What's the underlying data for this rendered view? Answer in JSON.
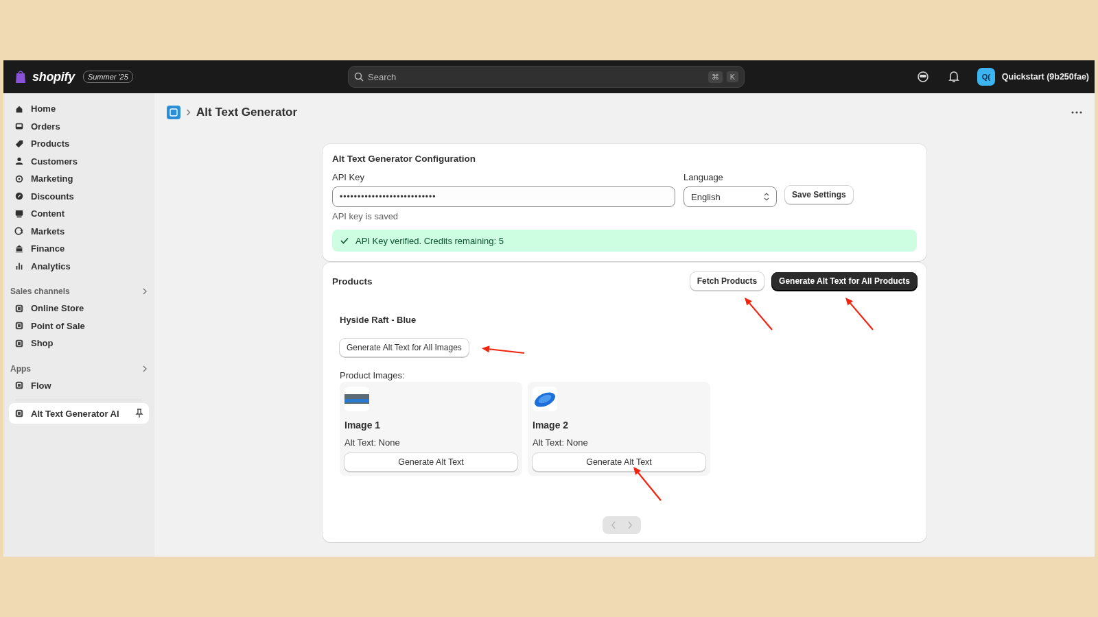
{
  "topbar": {
    "logo": "shopify",
    "badge": "Summer '25",
    "search": {
      "placeholder": "Search",
      "shortcut": [
        "⌘",
        "K"
      ]
    },
    "avatar": "Q(",
    "store": "Quickstart (9b250fae)"
  },
  "sidebar": {
    "items": [
      {
        "label": "Home",
        "selected": false
      },
      {
        "label": "Orders",
        "selected": false
      },
      {
        "label": "Products",
        "selected": false
      },
      {
        "label": "Customers",
        "selected": false
      },
      {
        "label": "Marketing",
        "selected": false
      },
      {
        "label": "Discounts",
        "selected": false
      },
      {
        "label": "Content",
        "selected": false
      },
      {
        "label": "Markets",
        "selected": false
      },
      {
        "label": "Finance",
        "selected": false
      },
      {
        "label": "Analytics",
        "selected": false
      }
    ],
    "sections": [
      {
        "title": "Sales channels",
        "items": [
          {
            "label": "Online Store",
            "selected": false
          },
          {
            "label": "Point of Sale",
            "selected": false
          },
          {
            "label": "Shop",
            "selected": false
          }
        ]
      },
      {
        "title": "Apps",
        "items": [
          {
            "label": "Flow",
            "selected": false
          }
        ]
      }
    ],
    "pinned_app": {
      "label": "Alt Text Generator AI",
      "selected": true
    }
  },
  "page": {
    "title": "Alt Text Generator"
  },
  "config": {
    "title": "Alt Text Generator Configuration",
    "api_key_label": "API Key",
    "api_key_value": "•••••••••••••••••••••••••••",
    "language_label": "Language",
    "language_value": "English",
    "save_button": "Save Settings",
    "help_text": "API key is saved",
    "banner": "API Key verified. Credits remaining: 5"
  },
  "products": {
    "title": "Products",
    "buttons": [
      {
        "label": "Fetch Products",
        "kind": "secondary"
      },
      {
        "label": "Generate Alt Text for All Products",
        "kind": "primary"
      }
    ],
    "product_name": "Hyside Raft - Blue",
    "all_images_button": "Generate Alt Text for All Images",
    "images_label": "Product Images:",
    "images": [
      {
        "title": "Image 1",
        "alt_text": "Alt Text: None",
        "button": "Generate Alt Text"
      },
      {
        "title": "Image 2",
        "alt_text": "Alt Text: None",
        "button": "Generate Alt Text"
      }
    ],
    "pagination": {
      "previous_disabled": true,
      "next_disabled": true
    }
  }
}
